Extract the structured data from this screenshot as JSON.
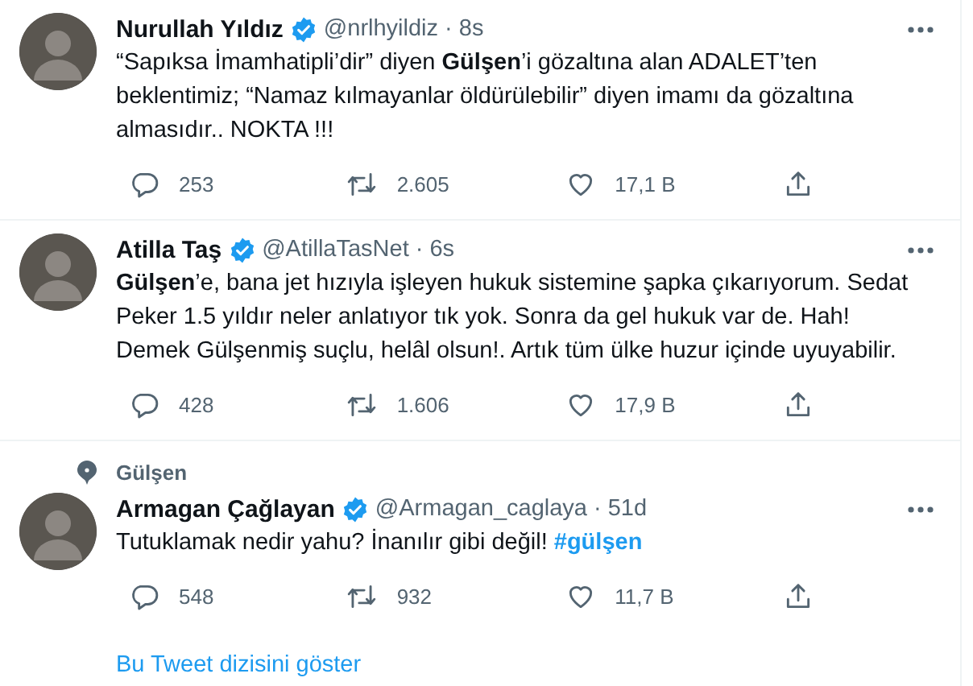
{
  "tweets": [
    {
      "name": "Nurullah Yıldız",
      "verified": true,
      "handle": "@nrlhyildiz",
      "separator": "·",
      "time": "8s",
      "body": [
        {
          "kind": "text",
          "text": "“Sapıksa İmamhatipli’dir” diyen **Gülşen**’i gözaltına alan ADALET’ten beklentimiz; “Namaz kılmayanlar öldürülebilir” diyen imamı da gözaltına almasıdır.. NOKTA !!!"
        }
      ],
      "replies": "253",
      "retweets": "2.605",
      "likes": "17,1 B"
    },
    {
      "name": "Atilla Taş",
      "verified": true,
      "handle": "@AtillaTasNet",
      "separator": "·",
      "time": "6s",
      "body": [
        {
          "kind": "text",
          "text": "**Gülşen**’e, bana jet hızıyla işleyen hukuk sistemine şapka çıkarıyorum. Sedat Peker 1.5 yıldır neler anlatıyor tık yok. Sonra da gel hukuk var de. Hah! Demek Gülşenmiş suçlu, helâl olsun!. Artık tüm ülke huzur içinde uyuyabilir."
        }
      ],
      "replies": "428",
      "retweets": "1.606",
      "likes": "17,9 B"
    },
    {
      "context": "Gülşen",
      "name": "Armagan Çağlayan",
      "verified": true,
      "handle": "@Armagan_caglaya",
      "separator": "·",
      "time": "51d",
      "body": [
        {
          "kind": "text",
          "text": "Tutuklamak nedir yahu? İnanılır gibi değil! "
        },
        {
          "kind": "hashtag",
          "text": "#gülşen"
        }
      ],
      "replies": "548",
      "retweets": "932",
      "likes": "11,7 B",
      "show_thread": "Bu Tweet dizisini göster"
    }
  ]
}
